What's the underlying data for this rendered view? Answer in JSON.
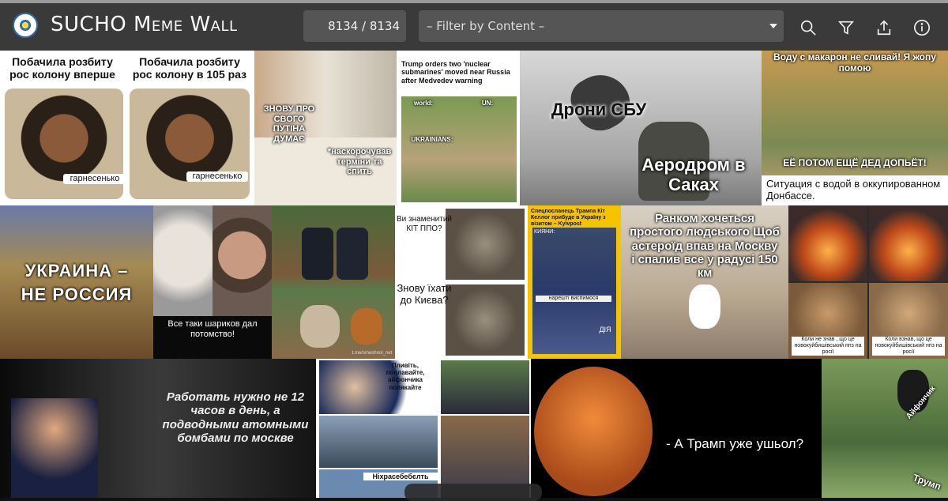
{
  "header": {
    "title": "SUCHO Meme Wall",
    "counter": "8134 / 8134",
    "filter_placeholder": "– Filter by Content –"
  },
  "icons": [
    "search-icon",
    "filter-icon",
    "share-icon",
    "info-icon"
  ],
  "memes": {
    "m1": {
      "left_title": "Побачила розбиту рос колону вперше",
      "right_title": "Побачила розбиту рос колону в 105 раз",
      "left_caption": "гарнесенько",
      "right_caption": "гарнесенько"
    },
    "m2": {
      "left_text": "ЗНОВУ ПРО СВОГО ПУТІНА ДУМАЄ",
      "right_text": "*наскорочував терміни та спить"
    },
    "m3": {
      "headline": "Trump orders two 'nuclear submarines' moved near Russia after Medvedev warning",
      "world": "world:",
      "un": "UN:",
      "ukrainians": "UKRAINIANS:"
    },
    "m4": {
      "top": "Дрони СБУ",
      "bottom": "Аеродром в Саках"
    },
    "m5": {
      "top": "Воду с макарон не сливай! Я жопу помою",
      "middle": "ЕЁ ПОТОМ ЕЩЁ ДЕД ДОПЬЁТ!",
      "caption": "Ситуация с водой в оккупированном Донбассе."
    },
    "m6": {
      "line1": "УКРАИНА –",
      "line2": "НЕ РОССИЯ"
    },
    "m7": {
      "caption": "Все таки шариков дал потомство!"
    },
    "m8": {
      "watermark": "t.me/smeshnoi_net"
    },
    "m9": {
      "top": "Ви знаменитий КІТ ППО?",
      "bottom": "Знову їхати до Києва?"
    },
    "m10": {
      "header": "Спецпосланець Трампа Кіт Келлог прибуде в Україну з візитом – Kyivpost",
      "label_top": "КИЯНИ:",
      "label_bottom": "нарешті виспимося",
      "logo": "ДІЯ"
    },
    "m11": {
      "text": "Ранком хочеться простого людського Щоб астероїд впав на Москву і спалив все у радусі 150 км"
    },
    "m12": {
      "left_caption": "Коли не знав , що це новокуйбишівський нпз на росії",
      "right_caption": "Коли взнав, що це новокуйбишівський нпз на росії"
    },
    "m13": {
      "text": "Работать нужно не 12 часов в день, а подводными атомными бомбами по москве"
    },
    "m14": {
      "top": "Пливіть, поплавайте, айфончика полякайте",
      "bottom": "Ніхрасебебєлть"
    },
    "m15": {
      "text": "- А Трамп уже ушьол?"
    },
    "m16": {
      "label1": "Айфончик",
      "label2": "Трумп"
    }
  },
  "colors": {
    "topbar": "#3a3a3a",
    "input_bg": "#555555",
    "accent_yellow": "#f5c400"
  }
}
